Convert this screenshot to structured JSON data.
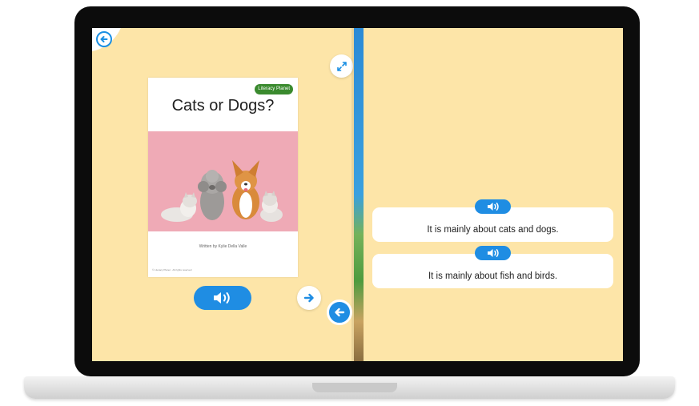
{
  "book": {
    "title": "Cats or Dogs?",
    "badge": "Literacy Planet",
    "author": "Written by Kylie Della Valle",
    "fine_print": "© Literacy Planet · All rights reserved"
  },
  "quiz": {
    "choices": [
      {
        "text": "It is mainly about cats and dogs."
      },
      {
        "text": "It is mainly about fish and birds."
      }
    ]
  },
  "icons": {
    "back": "back-arrow-icon",
    "expand": "expand-icon",
    "audio": "speaker-icon",
    "next": "right-arrow-icon",
    "prev": "left-arrow-icon"
  },
  "colors": {
    "background": "#fde5a8",
    "accent": "#1f8de3",
    "photo_background": "#efaab6"
  }
}
